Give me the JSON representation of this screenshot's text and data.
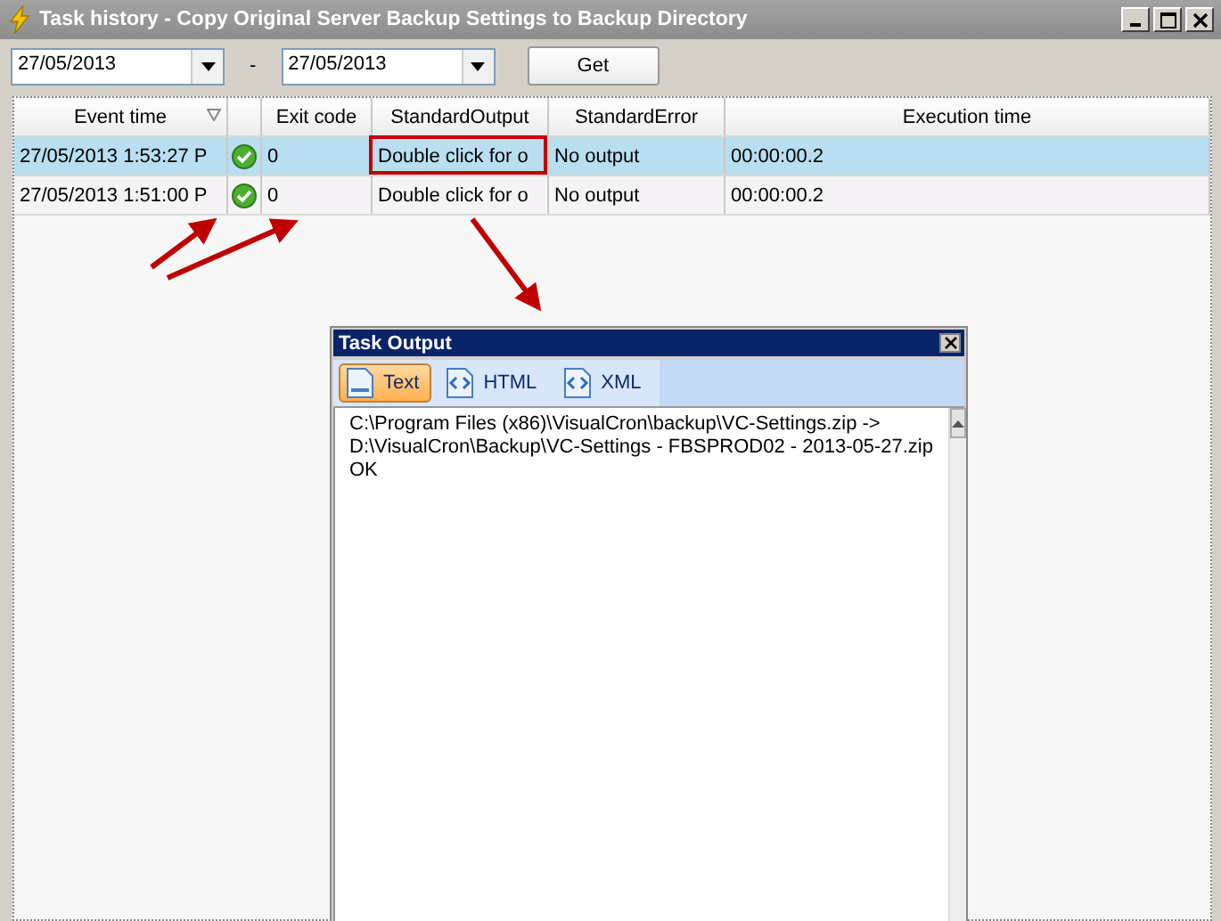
{
  "window": {
    "title": "Task history - Copy Original Server Backup Settings to Backup Directory"
  },
  "filter": {
    "from": "27/05/2013",
    "separator": "-",
    "to": "27/05/2013",
    "button": "Get"
  },
  "table": {
    "columns": [
      "Event time",
      "",
      "Exit code",
      "StandardOutput",
      "StandardError",
      "Execution time"
    ],
    "rows": [
      {
        "event_time": "27/05/2013 1:53:27 P",
        "success": true,
        "exit_code": "0",
        "standard_output": "Double click for o",
        "standard_error": "No output",
        "execution_time": "00:00:00.2",
        "selected": true
      },
      {
        "event_time": "27/05/2013 1:51:00 P",
        "success": true,
        "exit_code": "0",
        "standard_output": "Double click for o",
        "standard_error": "No output",
        "execution_time": "00:00:00.2",
        "selected": false
      }
    ]
  },
  "output_window": {
    "title": "Task Output",
    "tabs": [
      {
        "label": "Text",
        "selected": true
      },
      {
        "label": "HTML",
        "selected": false
      },
      {
        "label": "XML",
        "selected": false
      }
    ],
    "lines": [
      "C:\\Program Files (x86)\\VisualCron\\backup\\VC-Settings.zip    ->",
      "D:\\VisualCron\\Backup\\VC-Settings - FBSPROD02 - 2013-05-27.zip",
      "OK"
    ]
  }
}
